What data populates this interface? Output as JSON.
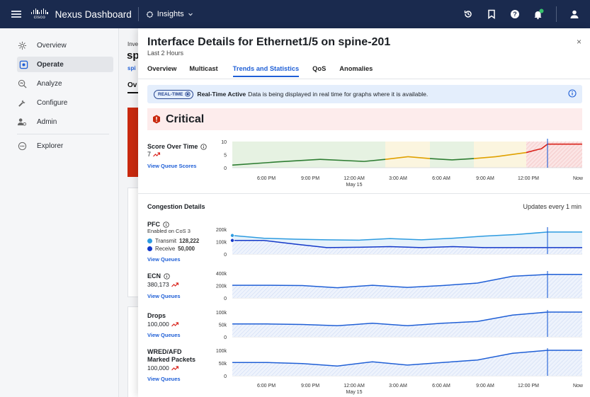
{
  "topbar": {
    "cisco_word": "cisco",
    "brand": "Nexus Dashboard",
    "section": "Insights",
    "icons": [
      "history-icon",
      "bookmark-icon",
      "help-icon",
      "notifications-icon",
      "user-icon"
    ]
  },
  "sidebar": {
    "items": [
      {
        "label": "Overview",
        "icon": "overview-icon"
      },
      {
        "label": "Operate",
        "icon": "operate-icon",
        "active": true
      },
      {
        "label": "Analyze",
        "icon": "analyze-icon"
      },
      {
        "label": "Configure",
        "icon": "configure-icon"
      },
      {
        "label": "Admin",
        "icon": "admin-icon"
      },
      {
        "label": "Explorer",
        "icon": "explorer-icon"
      }
    ]
  },
  "background": {
    "crumb": "Inve",
    "title": "sp",
    "link": "spi",
    "tab": "Ov"
  },
  "modal": {
    "title": "Interface Details for Ethernet1/5 on spine-201",
    "subtitle": "Last 2 Hours",
    "close": "×",
    "tabs": [
      "Overview",
      "Multicast",
      "Trends and Statistics",
      "QoS",
      "Anomalies"
    ],
    "active_tab": "Trends and Statistics",
    "realtime": {
      "pill": "REAL-TIME",
      "bold": "Real-Time Active",
      "text": "Data is being displayed in real time for graphs where it is available."
    },
    "severity": "Critical",
    "score": {
      "label": "Score Over Time",
      "value": "7",
      "link": "View Queue Scores",
      "yticks": [
        "10",
        "5",
        "0"
      ]
    },
    "time_axis": {
      "ticks": [
        "6:00 PM",
        "9:00 PM",
        "12:00 AM",
        "3:00 AM",
        "6:00 AM",
        "9:00 AM",
        "12:00 PM",
        "Now"
      ],
      "date": "May 15"
    },
    "congestion": {
      "title": "Congestion Details",
      "updates": "Updates every 1 min",
      "pfc": {
        "label": "PFC",
        "sub": "Enabled on CoS 3",
        "transmit_label": "Transmit",
        "transmit_value": "128,222",
        "receive_label": "Receive",
        "receive_value": "50,000",
        "link": "View Queues",
        "yticks": [
          "200k",
          "100k",
          "0"
        ]
      },
      "ecn": {
        "label": "ECN",
        "value": "380,173",
        "link": "View Queues",
        "yticks": [
          "400k",
          "200k",
          "0"
        ]
      },
      "drops": {
        "label": "Drops",
        "value": "100,000",
        "link": "View Queues",
        "yticks": [
          "100k",
          "50k",
          "0"
        ]
      },
      "wred": {
        "label1": "WRED/AFD",
        "label2": "Marked Packets",
        "value": "100,000",
        "link": "View Queues",
        "yticks": [
          "100k",
          "50k",
          "0"
        ]
      }
    }
  },
  "colors": {
    "topbar": "#1a2a4e",
    "accent": "#1f5fd6",
    "critical": "#c9290e",
    "score_green": "#2e7d32",
    "score_yellow": "#e0a100",
    "score_red": "#d9231b",
    "transmit": "#2d9be0",
    "receive": "#1338c9"
  },
  "chart_data": [
    {
      "type": "line",
      "name": "score",
      "x": [
        "3:30 PM",
        "6:00 PM",
        "9:00 PM",
        "12:00 AM",
        "1:30 AM",
        "3:00 AM",
        "4:30 AM",
        "6:00 AM",
        "7:30 AM",
        "9:00 AM",
        "10:30 AM",
        "11:45 AM",
        "12:00 PM",
        "12:15 PM",
        "Now"
      ],
      "values": [
        1,
        2.2,
        3.2,
        2.4,
        3.2,
        4.2,
        3.5,
        3.0,
        3.5,
        4.2,
        5.8,
        7.0,
        7.2,
        9.0,
        9.0
      ],
      "ylim": [
        0,
        10
      ],
      "bands": [
        "green",
        "green",
        "green",
        "green",
        "yellow",
        "yellow",
        "green",
        "green",
        "yellow",
        "yellow",
        "red",
        "red",
        "red",
        "red"
      ]
    },
    {
      "type": "area",
      "name": "pfc",
      "series": [
        {
          "name": "Transmit",
          "values": [
            150000,
            128000,
            120000,
            115000,
            112000,
            125000,
            115000,
            128000,
            145000,
            158000,
            178000,
            178000
          ]
        },
        {
          "name": "Receive",
          "values": [
            110000,
            110000,
            80000,
            52000,
            55000,
            60000,
            52000,
            60000,
            52000,
            52000,
            52000,
            52000
          ]
        }
      ],
      "ylim": [
        0,
        200000
      ]
    },
    {
      "type": "area",
      "name": "ecn",
      "values": [
        205000,
        205000,
        200000,
        165000,
        205000,
        170000,
        200000,
        240000,
        350000,
        380000,
        380000
      ],
      "ylim": [
        0,
        400000
      ]
    },
    {
      "type": "area",
      "name": "drops",
      "values": [
        52000,
        52000,
        50000,
        45000,
        55000,
        45000,
        55000,
        62000,
        88000,
        100000,
        100000
      ],
      "ylim": [
        0,
        100000
      ]
    },
    {
      "type": "area",
      "name": "wred",
      "values": [
        52000,
        52000,
        48000,
        38000,
        55000,
        42000,
        52000,
        62000,
        88000,
        100000,
        100000
      ],
      "ylim": [
        0,
        100000
      ]
    }
  ]
}
